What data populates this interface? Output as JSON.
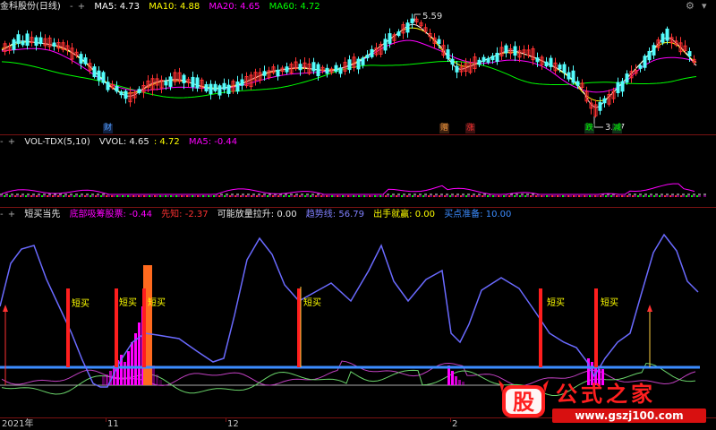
{
  "colors": {
    "up": "#ff3232",
    "down": "#54fcfc",
    "ma5": "#ffffff",
    "ma10": "#ffff00",
    "ma20": "#ff00ff",
    "ma60": "#00ff00",
    "grid": "#7a1212",
    "trend": "#6a6aff",
    "baseline": "#3c8cff",
    "duanmai": "#ff1e1e",
    "bottom_bars": "#ff00ff",
    "prebuy": "#ff6a1e",
    "label_yellow": "#ffff00"
  },
  "main": {
    "controls": [
      "-",
      "+"
    ],
    "title": "金科股份(日线)",
    "ma5": "MA5: 4.73",
    "ma10": "MA10: 4.88",
    "ma20": "MA20: 4.65",
    "ma60": "MA60: 4.72",
    "high_label": "5.59",
    "low_label": "3.57",
    "markers": [
      {
        "text": "财",
        "color": "#54a0ff"
      },
      {
        "text": "赠",
        "color": "#ffa040"
      },
      {
        "text": "涨",
        "color": "#ff3232"
      },
      {
        "text": "跌",
        "color": "#00ff00"
      },
      {
        "text": "减",
        "color": "#00ff00"
      }
    ]
  },
  "vol": {
    "controls": [
      "-",
      "+"
    ],
    "title": "VOL-TDX(5,10)",
    "vvol": "VVOL: 4.65",
    "val2": ": 4.72",
    "ma5": "MA5: -0.44"
  },
  "indicator": {
    "controls": [
      "-",
      "+"
    ],
    "title": "短买当先",
    "dibu": "底部吸筹股票: -0.44",
    "xianzhi": "先知: -2.37",
    "kenengfang": "可能放量拉升: 0.00",
    "qushixian": "趋势线: 56.79",
    "chushou": "出手就赢: 0.00",
    "maidian": "买点准备: 10.00",
    "signal_label": "短买"
  },
  "xaxis": {
    "labels": [
      "2021年",
      "11",
      "12",
      "2"
    ]
  },
  "watermark": {
    "logo_char": "股",
    "title": "公式之家",
    "url": "www.gszj100.com"
  }
}
